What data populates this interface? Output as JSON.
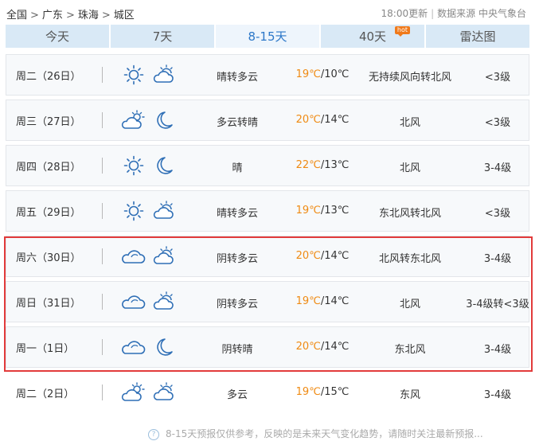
{
  "breadcrumb": [
    "全国",
    "广东",
    "珠海",
    "城区"
  ],
  "breadcrumb_sep": ">",
  "meta": {
    "update": "18:00更新",
    "source": "数据来源 中央气象台"
  },
  "tabs": [
    {
      "label": "今天"
    },
    {
      "label": "7天"
    },
    {
      "label": "8-15天",
      "active": true
    },
    {
      "label": "40天",
      "badge": "hot"
    },
    {
      "label": "雷达图"
    }
  ],
  "colors": {
    "accent": "#2c77c8",
    "tab_bg": "#d9e9f6",
    "high_temp": "#ef8a12",
    "highlight_border": "#e23b3b",
    "icon_stroke": "#2f6fb6"
  },
  "forecast": [
    {
      "day": "周二（26日）",
      "icon1": "sun-icon",
      "icon2": "cloudy-icon",
      "condition": "晴转多云",
      "high": "19℃",
      "low": "/10℃",
      "wind": "无持续风向转北风",
      "level": "<3级"
    },
    {
      "day": "周三（27日）",
      "icon1": "partly-cloudy-icon",
      "icon2": "moon-icon",
      "condition": "多云转晴",
      "high": "20℃",
      "low": "/14℃",
      "wind": "北风",
      "level": "<3级"
    },
    {
      "day": "周四（28日）",
      "icon1": "sun-icon",
      "icon2": "moon-icon",
      "condition": "晴",
      "high": "22℃",
      "low": "/13℃",
      "wind": "北风",
      "level": "3-4级"
    },
    {
      "day": "周五（29日）",
      "icon1": "sun-icon",
      "icon2": "cloudy-icon",
      "condition": "晴转多云",
      "high": "19℃",
      "low": "/13℃",
      "wind": "东北风转北风",
      "level": "<3级"
    },
    {
      "day": "周六（30日）",
      "icon1": "overcast-icon",
      "icon2": "cloudy-icon",
      "condition": "阴转多云",
      "high": "20℃",
      "low": "/14℃",
      "wind": "北风转东北风",
      "level": "3-4级"
    },
    {
      "day": "周日（31日）",
      "icon1": "overcast-icon",
      "icon2": "cloudy-icon",
      "condition": "阴转多云",
      "high": "19℃",
      "low": "/14℃",
      "wind": "北风",
      "level": "3-4级转<3级"
    },
    {
      "day": "周一（1日）",
      "icon1": "overcast-icon",
      "icon2": "moon-icon",
      "condition": "阴转晴",
      "high": "20℃",
      "low": "/14℃",
      "wind": "东北风",
      "level": "3-4级"
    },
    {
      "day": "周二（2日）",
      "icon1": "partly-cloudy-icon",
      "icon2": "cloudy-icon",
      "condition": "多云",
      "high": "19℃",
      "low": "/15℃",
      "wind": "东风",
      "level": "3-4级"
    }
  ],
  "footer": {
    "text": "8-15天预报仅供参考，反映的是未来天气变化趋势，请随时关注最新预报..."
  }
}
